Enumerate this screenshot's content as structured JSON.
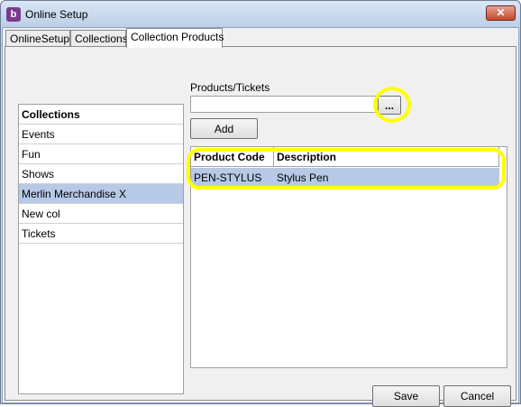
{
  "window": {
    "icon_glyph": "b",
    "title": "Online Setup",
    "close_glyph": "✕"
  },
  "tabs": [
    {
      "label": "OnlineSetup"
    },
    {
      "label": "Collections"
    },
    {
      "label": "Collection Products",
      "active": true
    }
  ],
  "collections": {
    "header": "Collections",
    "items": [
      "Events",
      "Fun",
      "Shows",
      "Merlin Merchandise X",
      "New col",
      "Tickets"
    ],
    "selected": "Merlin Merchandise X"
  },
  "products": {
    "label": "Products/Tickets",
    "value": "",
    "browse_label": "...",
    "add_label": "Add"
  },
  "grid": {
    "columns": [
      "Product Code",
      "Description"
    ],
    "rows": [
      {
        "code": "PEN-STYLUS",
        "description": "Stylus Pen"
      }
    ]
  },
  "footer": {
    "save_label": "Save",
    "cancel_label": "Cancel"
  },
  "colors": {
    "highlight": "#ffff00",
    "selection": "#b7c9e6"
  }
}
